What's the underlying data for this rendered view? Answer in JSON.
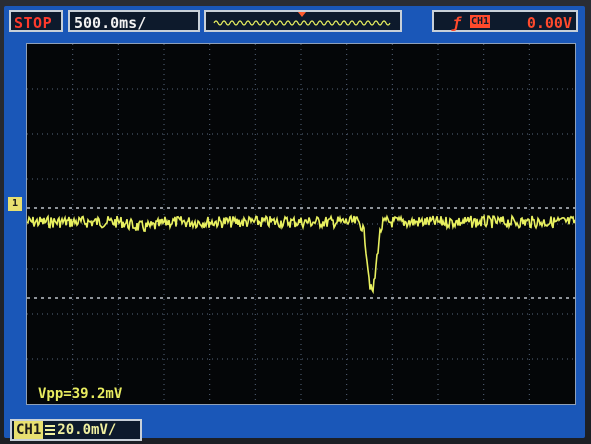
{
  "status": {
    "run_state": "STOP",
    "timebase": "500.0ms/"
  },
  "trigger": {
    "icon": "ƒ",
    "source": "CH1",
    "level": "0.00V"
  },
  "channel": {
    "marker": "1",
    "label": "CH1",
    "volts_div": "20.0mV/"
  },
  "measurement": {
    "vpp": "Vpp=39.2mV"
  },
  "colors": {
    "trace": "#e8f060",
    "frame": "#1a57b8",
    "grid": "#5a6a80"
  }
}
